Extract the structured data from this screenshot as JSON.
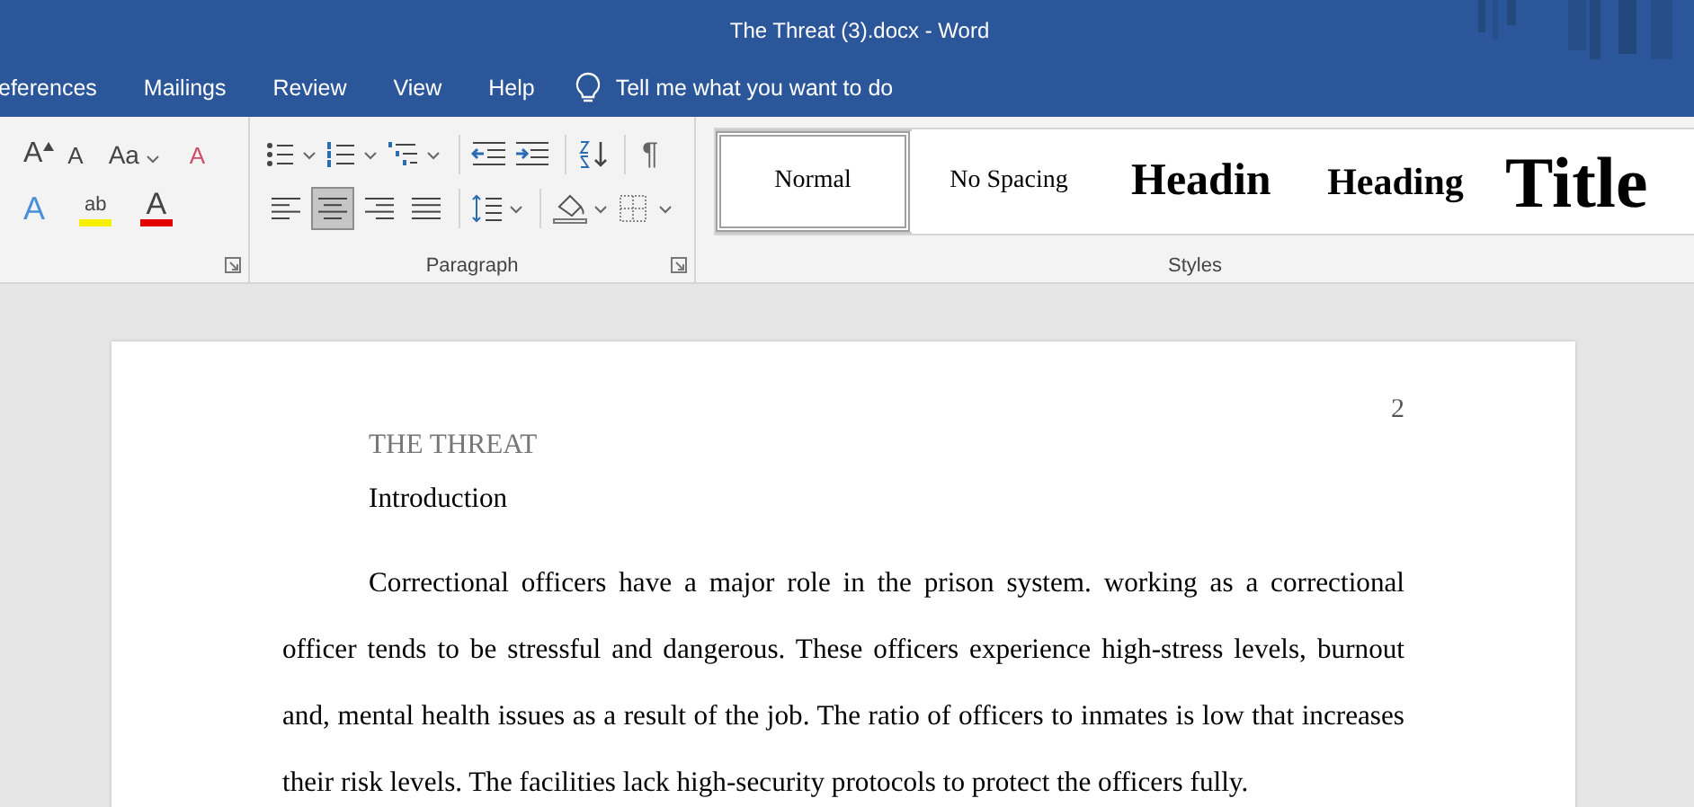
{
  "window": {
    "title": "The Threat (3).docx  -  Word"
  },
  "tabs": [
    {
      "label": "eferences",
      "selected": false
    },
    {
      "label": "Mailings",
      "selected": false
    },
    {
      "label": "Review",
      "selected": false
    },
    {
      "label": "View",
      "selected": false
    },
    {
      "label": "Help",
      "selected": false
    }
  ],
  "tell_me": {
    "placeholder": "Tell me what you want to do"
  },
  "font_group": {
    "row1": [
      {
        "kind": "grow",
        "glyph": "A"
      },
      {
        "kind": "shrink",
        "glyph": "A"
      },
      {
        "kind": "case",
        "glyph": "Aa"
      },
      {
        "kind": "clear",
        "glyph": "A"
      }
    ],
    "row2": [
      {
        "kind": "effects",
        "glyph": "A"
      },
      {
        "kind": "highlight",
        "glyph": "ab"
      },
      {
        "kind": "fontcolor",
        "glyph": "A"
      }
    ]
  },
  "paragraph_group": {
    "label": "Paragraph",
    "pilcrow": "¶",
    "align_buttons": [
      {
        "kind": "left",
        "selected": false
      },
      {
        "kind": "center",
        "selected": true
      },
      {
        "kind": "right",
        "selected": false
      },
      {
        "kind": "justify",
        "selected": false
      }
    ]
  },
  "styles_group": {
    "label": "Styles",
    "styles": [
      {
        "label": "Normal",
        "kind": "normal",
        "selected": true
      },
      {
        "label": "No Spacing",
        "kind": "nospacing",
        "selected": false
      },
      {
        "label": "Headin",
        "kind": "heading1",
        "selected": false
      },
      {
        "label": "Heading",
        "kind": "heading2",
        "selected": false
      },
      {
        "label": "Title",
        "kind": "title",
        "selected": false
      }
    ]
  },
  "document": {
    "page_number": "2",
    "running_head": "THE THREAT",
    "heading": "Introduction",
    "paragraph": "Correctional officers have a major role in the prison system. working as a correctional officer tends to be stressful and dangerous. These officers experience high-stress levels, burnout and, mental health issues as a result of the job. The ratio of officers to inmates is low that increases their risk levels. The facilities lack high-security protocols to protect the officers fully."
  }
}
